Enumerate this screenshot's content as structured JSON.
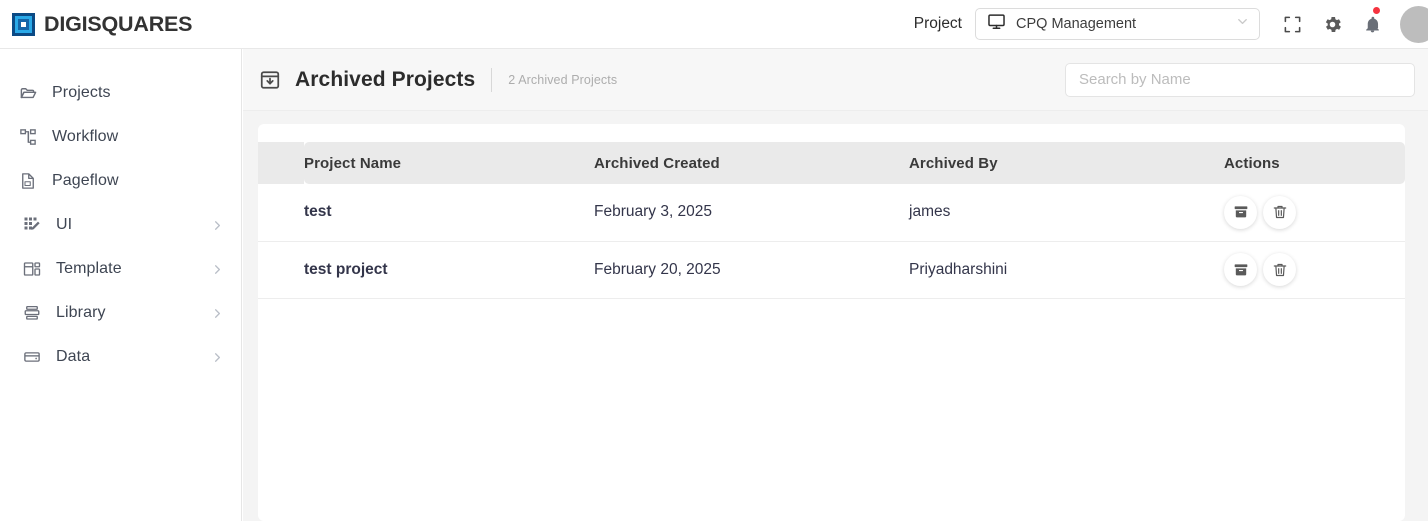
{
  "brand": {
    "name": "DIGISQUARES",
    "logo_icon": "nested-squares-logo-icon",
    "colors": {
      "outer": "#0b4a85",
      "mid": "#2aa9e8",
      "inner": "#1565a8"
    }
  },
  "topbar": {
    "project_label": "Project",
    "project_select": {
      "value": "CPQ Management",
      "icon": "monitor-icon",
      "chevron": "chevron-down-icon"
    },
    "fullscreen_icon": "fullscreen-icon",
    "settings_icon": "gear-icon",
    "notifications_icon": "bell-icon",
    "notification_dot_color": "#f5333f",
    "avatar": "user-avatar"
  },
  "sidebar": {
    "items": [
      {
        "label": "Projects",
        "icon": "folder-icon",
        "has_chevron": false
      },
      {
        "label": "Workflow",
        "icon": "workflow-icon",
        "has_chevron": false
      },
      {
        "label": "Pageflow",
        "icon": "page-icon",
        "has_chevron": false
      },
      {
        "label": "UI",
        "icon": "ui-grid-icon",
        "has_chevron": true
      },
      {
        "label": "Template",
        "icon": "template-icon",
        "has_chevron": true
      },
      {
        "label": "Library",
        "icon": "library-icon",
        "has_chevron": true
      },
      {
        "label": "Data",
        "icon": "data-drawer-icon",
        "has_chevron": true
      }
    ]
  },
  "page": {
    "title": "Archived Projects",
    "title_icon": "archive-download-icon",
    "subtitle": "2 Archived Projects",
    "search_placeholder": "Search by Name",
    "search_value": ""
  },
  "table": {
    "columns": [
      "Project Name",
      "Archived Created",
      "Archived By",
      "Actions"
    ],
    "rows": [
      {
        "project_name": "test",
        "archived_created": "February 3, 2025",
        "archived_by": "james",
        "actions": [
          {
            "name": "unarchive-button",
            "icon": "archive-box-icon"
          },
          {
            "name": "delete-button",
            "icon": "trash-icon"
          }
        ]
      },
      {
        "project_name": "test project",
        "archived_created": "February 20, 2025",
        "archived_by": "Priyadharshini",
        "actions": [
          {
            "name": "unarchive-button",
            "icon": "archive-box-icon"
          },
          {
            "name": "delete-button",
            "icon": "trash-icon"
          }
        ]
      }
    ]
  }
}
